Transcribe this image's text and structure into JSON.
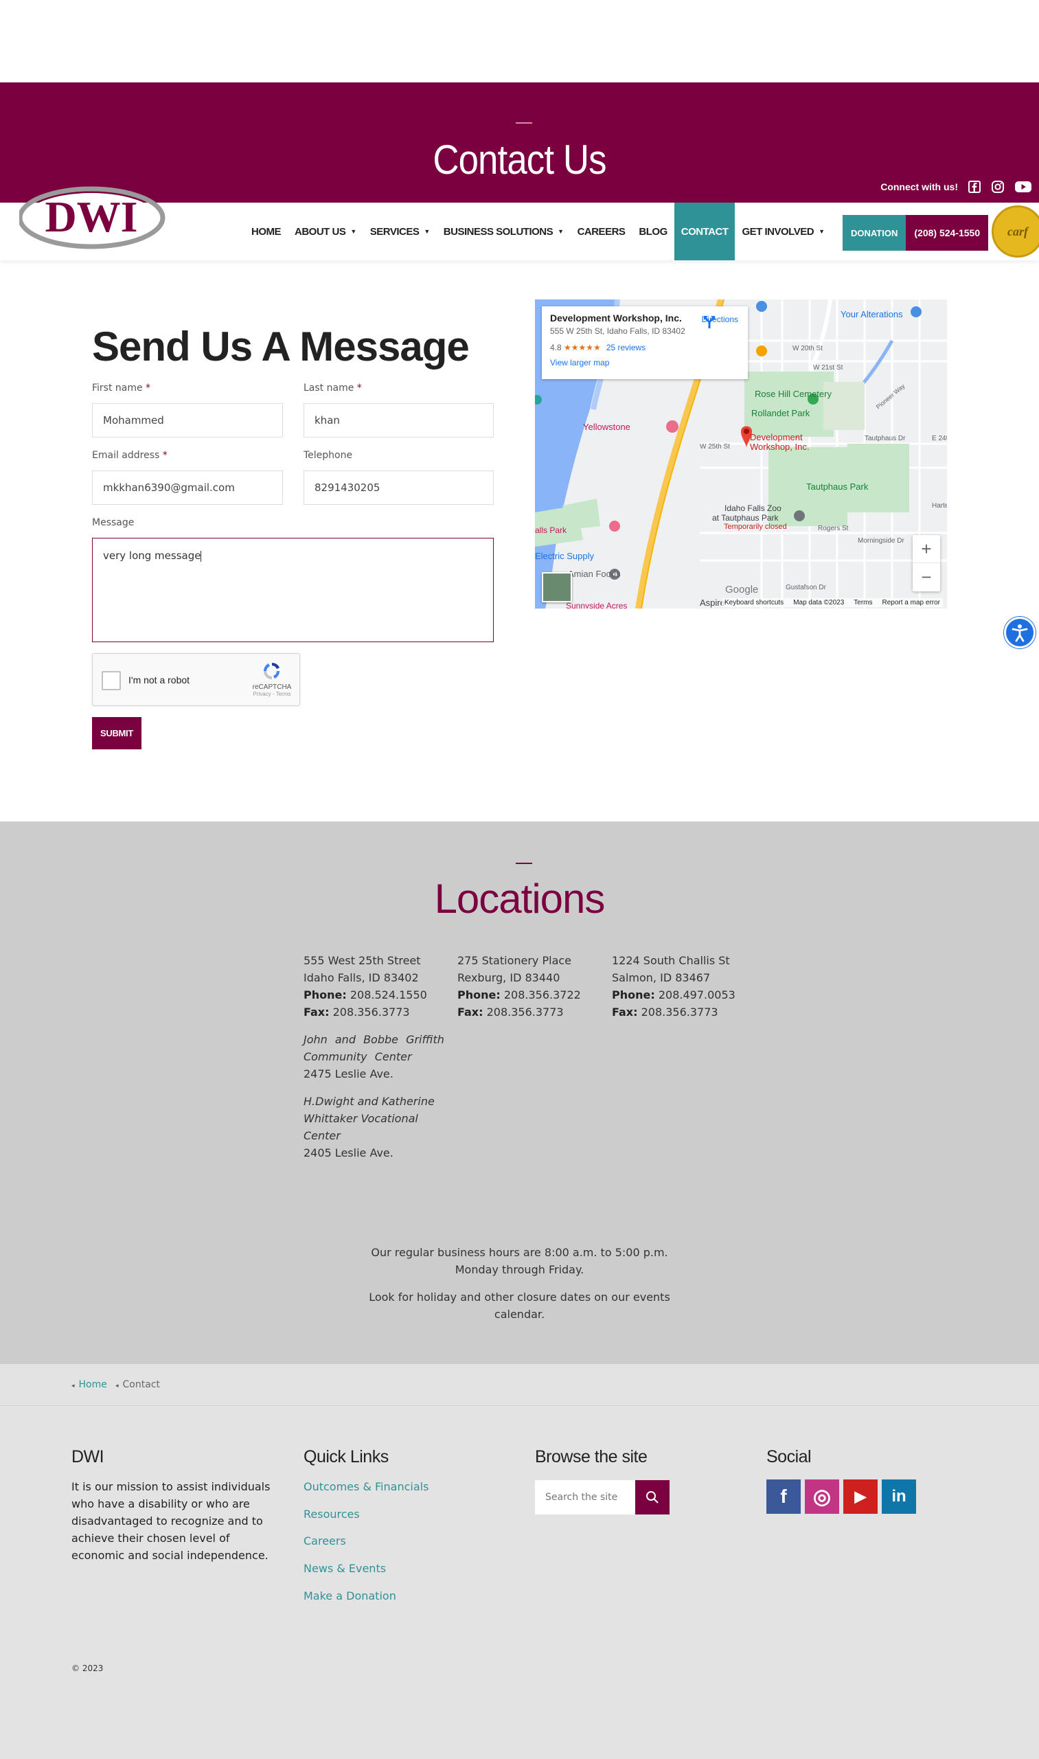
{
  "hero": {
    "title": "Contact Us"
  },
  "connect": {
    "label": "Connect with us!",
    "icons": [
      "facebook-icon",
      "instagram-icon",
      "youtube-icon"
    ]
  },
  "logo": {
    "text": "DWI"
  },
  "nav": {
    "items": [
      {
        "label": "HOME",
        "dropdown": false
      },
      {
        "label": "ABOUT US",
        "dropdown": true
      },
      {
        "label": "SERVICES",
        "dropdown": true
      },
      {
        "label": "BUSINESS SOLUTIONS",
        "dropdown": true
      },
      {
        "label": "CAREERS",
        "dropdown": false
      },
      {
        "label": "BLOG",
        "dropdown": false
      },
      {
        "label": "CONTACT",
        "dropdown": false,
        "active": true
      },
      {
        "label": "GET INVOLVED",
        "dropdown": true
      }
    ],
    "donation": "DONATION",
    "phone": "(208) 524-1550",
    "badge": "carf"
  },
  "form": {
    "title": "Send Us A Message",
    "first_name_label": "First name",
    "first_name_value": "Mohammed",
    "last_name_label": "Last name",
    "last_name_value": "khan",
    "email_label": "Email address",
    "email_value": "mkkhan6390@gmail.com",
    "telephone_label": "Telephone",
    "telephone_value": "8291430205",
    "message_label": "Message",
    "message_value": "very long message",
    "required_mark": "*",
    "recaptcha_label": "I'm not a robot",
    "recaptcha_brand": "reCAPTCHA",
    "recaptcha_links": "Privacy - Terms",
    "submit": "SUBMIT"
  },
  "map": {
    "place_name": "Development Workshop, Inc.",
    "address": "555 W 25th St, Idaho Falls, ID 83402",
    "rating": "4.8",
    "stars": "★★★★★",
    "reviews": "25 reviews",
    "directions": "Directions",
    "larger_map": "View larger map",
    "pin_label_1": "Development",
    "pin_label_2": "Workshop, Inc.",
    "labels": {
      "your_alterations": "Your Alterations",
      "rose_hill": "Rose Hill Cemetery",
      "rollandet": "Rollandet Park",
      "yellowstone": "Yellowstone",
      "tautphaus_park": "Tautphaus Park",
      "zoo_1": "Idaho Falls Zoo",
      "zoo_2": "at Tautphaus Park",
      "zoo_3": "Temporarily closed",
      "electric": "Electric Supply",
      "foods": "Amian Foods",
      "falls_park": "alls Park",
      "aspire": "Aspire",
      "sunnyside": "Sunnyside Acres",
      "w20": "W 20th St",
      "w21": "W 21st St",
      "w25": "W 25th St",
      "tautphaus_dr": "Tautphaus Dr",
      "rogers": "Rogers St",
      "gustafson": "Gustafson Dr",
      "morningside": "Morningside Dr",
      "e24": "E 24t",
      "hart": "Harte",
      "pioneer": "Pioneer Way"
    },
    "zoom_in": "+",
    "zoom_out": "−",
    "google": "Google",
    "footer_keyboard": "Keyboard shortcuts",
    "footer_data": "Map data ©2023",
    "footer_terms": "Terms",
    "footer_report": "Report a map error"
  },
  "locations": {
    "title": "Locations",
    "col1": {
      "street": "555 West 25th Street",
      "city": "Idaho Falls, ID 83402",
      "phone_label": "Phone:",
      "phone": "208.524.1550",
      "fax_label": "Fax:",
      "fax": "208.356.3773",
      "center1_line1": "John and Bobbe Griffith",
      "center1_line2": "Community Center",
      "center1_addr": "2475 Leslie Ave.",
      "center2_line1": "H.Dwight and Katherine",
      "center2_line2": "Whittaker Vocational",
      "center2_line3": "Center",
      "center2_addr": "2405 Leslie Ave."
    },
    "col2": {
      "street": "275 Stationery Place",
      "city": "Rexburg, ID 83440",
      "phone_label": "Phone:",
      "phone": "208.356.3722",
      "fax_label": "Fax:",
      "fax": "208.356.3773"
    },
    "col3": {
      "street": "1224 South Challis St",
      "city": "Salmon, ID 83467",
      "phone_label": "Phone:",
      "phone": "208.497.0053",
      "fax_label": "Fax:",
      "fax": "208.356.3773"
    },
    "hours_1": "Our regular business hours are 8:00 a.m. to 5:00 p.m.",
    "hours_2": "Monday through Friday.",
    "holiday_1": "Look for holiday and other closure dates on our events",
    "holiday_2": "calendar."
  },
  "breadcrumb": {
    "home": "Home",
    "current": "Contact"
  },
  "footer": {
    "dwi_title": "DWI",
    "dwi_text": "It is our mission to assist individuals who have a disability or who are disadvantaged to recognize and to achieve their chosen level of economic and social independence.",
    "quick_title": "Quick Links",
    "links": [
      "Outcomes & Financials",
      "Resources",
      "Careers",
      "News & Events",
      "Make a Donation"
    ],
    "browse_title": "Browse the site",
    "search_placeholder": "Search the site",
    "social_title": "Social",
    "social": [
      {
        "name": "facebook",
        "glyph": "f",
        "color": "#3b5998"
      },
      {
        "name": "instagram",
        "glyph": "◎",
        "color": "#c13584"
      },
      {
        "name": "youtube",
        "glyph": "▶",
        "color": "#cd201f"
      },
      {
        "name": "linkedin",
        "glyph": "in",
        "color": "#0e76a8"
      }
    ],
    "copyright": "© 2023"
  },
  "colors": {
    "brand": "#7a0040",
    "accent": "#2f9296",
    "locations_bg": "#cccccc",
    "footer_bg": "#e3e3e3"
  }
}
